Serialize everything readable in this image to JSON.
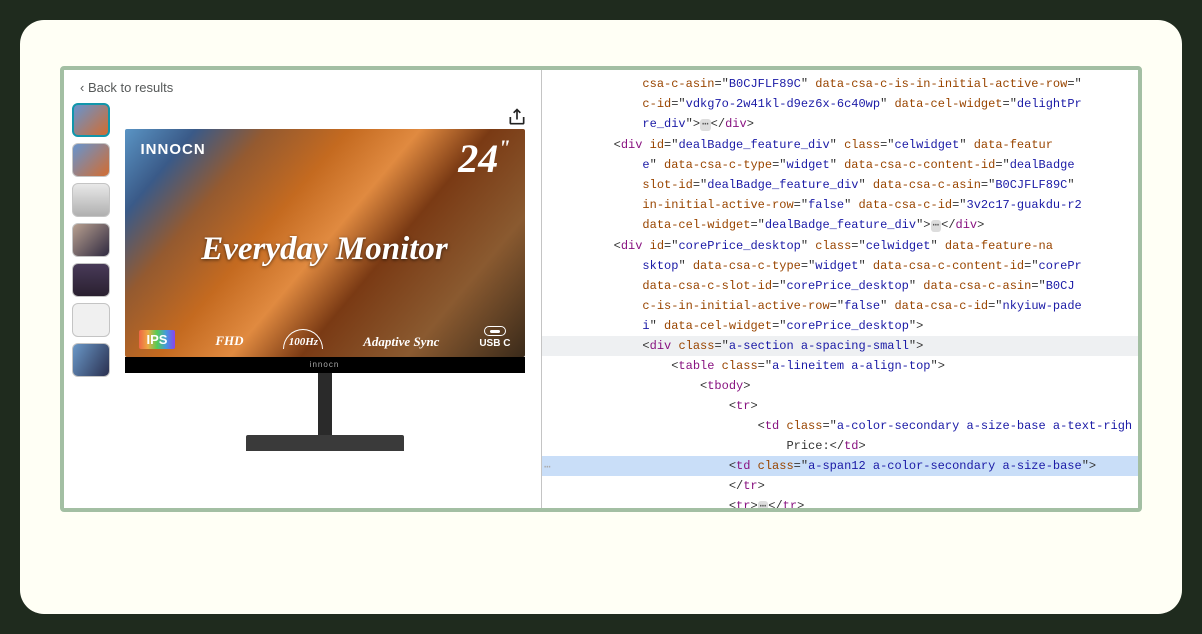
{
  "left": {
    "back_label": "Back to results",
    "thumbnails": [
      "t1",
      "t1",
      "t2",
      "t3",
      "t4",
      "t5",
      "t6"
    ],
    "product": {
      "brand": "INNOCN",
      "size_label": "24",
      "size_suffix": "\"",
      "hero": "Everyday Monitor",
      "ips": "IPS",
      "fhd": "FHD",
      "hz": "100Hz",
      "sync": "Adaptive Sync",
      "usbc": "USB C",
      "bezel_brand": "innocn"
    }
  },
  "code": {
    "lines": [
      {
        "indent": 6,
        "arrow": "",
        "tokens": [
          [
            "attr-name",
            "csa-c-asin"
          ],
          [
            "punct",
            "=\""
          ],
          [
            "attr-val",
            "B0CJFLF89C"
          ],
          [
            "punct",
            "\" "
          ],
          [
            "attr-name",
            "data-csa-c-is-in-initial-active-row"
          ],
          [
            "punct",
            "=\""
          ]
        ]
      },
      {
        "indent": 6,
        "arrow": "",
        "tokens": [
          [
            "attr-name",
            "c-id"
          ],
          [
            "punct",
            "=\""
          ],
          [
            "attr-val",
            "vdkg7o-2w41kl-d9ez6x-6c40wp"
          ],
          [
            "punct",
            "\" "
          ],
          [
            "attr-name",
            "data-cel-widget"
          ],
          [
            "punct",
            "=\""
          ],
          [
            "attr-val",
            "delightPr"
          ]
        ]
      },
      {
        "indent": 6,
        "arrow": "",
        "tokens": [
          [
            "attr-val",
            "re_div"
          ],
          [
            "punct",
            "\">"
          ],
          [
            "ell",
            "⋯"
          ],
          [
            "punct",
            "</"
          ],
          [
            "tag",
            "div"
          ],
          [
            "punct",
            ">"
          ]
        ]
      },
      {
        "indent": 4,
        "arrow": "▶",
        "tokens": [
          [
            "punct",
            "<"
          ],
          [
            "tag",
            "div"
          ],
          [
            "punct",
            " "
          ],
          [
            "attr-name",
            "id"
          ],
          [
            "punct",
            "=\""
          ],
          [
            "attr-val",
            "dealBadge_feature_div"
          ],
          [
            "punct",
            "\" "
          ],
          [
            "attr-name",
            "class"
          ],
          [
            "punct",
            "=\""
          ],
          [
            "attr-val",
            "celwidget"
          ],
          [
            "punct",
            "\" "
          ],
          [
            "attr-name",
            "data-featur"
          ]
        ]
      },
      {
        "indent": 6,
        "arrow": "",
        "tokens": [
          [
            "attr-val",
            "e"
          ],
          [
            "punct",
            "\" "
          ],
          [
            "attr-name",
            "data-csa-c-type"
          ],
          [
            "punct",
            "=\""
          ],
          [
            "attr-val",
            "widget"
          ],
          [
            "punct",
            "\" "
          ],
          [
            "attr-name",
            "data-csa-c-content-id"
          ],
          [
            "punct",
            "=\""
          ],
          [
            "attr-val",
            "dealBadge"
          ]
        ]
      },
      {
        "indent": 6,
        "arrow": "",
        "tokens": [
          [
            "attr-name",
            "slot-id"
          ],
          [
            "punct",
            "=\""
          ],
          [
            "attr-val",
            "dealBadge_feature_div"
          ],
          [
            "punct",
            "\" "
          ],
          [
            "attr-name",
            "data-csa-c-asin"
          ],
          [
            "punct",
            "=\""
          ],
          [
            "attr-val",
            "B0CJFLF89C"
          ],
          [
            "punct",
            "\""
          ]
        ]
      },
      {
        "indent": 6,
        "arrow": "",
        "tokens": [
          [
            "attr-name",
            "in-initial-active-row"
          ],
          [
            "punct",
            "=\""
          ],
          [
            "attr-val",
            "false"
          ],
          [
            "punct",
            "\" "
          ],
          [
            "attr-name",
            "data-csa-c-id"
          ],
          [
            "punct",
            "=\""
          ],
          [
            "attr-val",
            "3v2c17-guakdu-r2"
          ]
        ]
      },
      {
        "indent": 6,
        "arrow": "",
        "tokens": [
          [
            "attr-name",
            "data-cel-widget"
          ],
          [
            "punct",
            "=\""
          ],
          [
            "attr-val",
            "dealBadge_feature_div"
          ],
          [
            "punct",
            "\">"
          ],
          [
            "ell",
            "⋯"
          ],
          [
            "punct",
            "</"
          ],
          [
            "tag",
            "div"
          ],
          [
            "punct",
            ">"
          ]
        ]
      },
      {
        "indent": 4,
        "arrow": "▼",
        "tokens": [
          [
            "punct",
            "<"
          ],
          [
            "tag",
            "div"
          ],
          [
            "punct",
            " "
          ],
          [
            "attr-name",
            "id"
          ],
          [
            "punct",
            "=\""
          ],
          [
            "attr-val",
            "corePrice_desktop"
          ],
          [
            "punct",
            "\" "
          ],
          [
            "attr-name",
            "class"
          ],
          [
            "punct",
            "=\""
          ],
          [
            "attr-val",
            "celwidget"
          ],
          [
            "punct",
            "\" "
          ],
          [
            "attr-name",
            "data-feature-na"
          ]
        ]
      },
      {
        "indent": 6,
        "arrow": "",
        "tokens": [
          [
            "attr-val",
            "sktop"
          ],
          [
            "punct",
            "\" "
          ],
          [
            "attr-name",
            "data-csa-c-type"
          ],
          [
            "punct",
            "=\""
          ],
          [
            "attr-val",
            "widget"
          ],
          [
            "punct",
            "\" "
          ],
          [
            "attr-name",
            "data-csa-c-content-id"
          ],
          [
            "punct",
            "=\""
          ],
          [
            "attr-val",
            "corePr"
          ]
        ]
      },
      {
        "indent": 6,
        "arrow": "",
        "tokens": [
          [
            "attr-name",
            "data-csa-c-slot-id"
          ],
          [
            "punct",
            "=\""
          ],
          [
            "attr-val",
            "corePrice_desktop"
          ],
          [
            "punct",
            "\" "
          ],
          [
            "attr-name",
            "data-csa-c-asin"
          ],
          [
            "punct",
            "=\""
          ],
          [
            "attr-val",
            "B0CJ"
          ]
        ]
      },
      {
        "indent": 6,
        "arrow": "",
        "tokens": [
          [
            "attr-name",
            "c-is-in-initial-active-row"
          ],
          [
            "punct",
            "=\""
          ],
          [
            "attr-val",
            "false"
          ],
          [
            "punct",
            "\" "
          ],
          [
            "attr-name",
            "data-csa-c-id"
          ],
          [
            "punct",
            "=\""
          ],
          [
            "attr-val",
            "nkyiuw-pade"
          ]
        ]
      },
      {
        "indent": 6,
        "arrow": "",
        "tokens": [
          [
            "attr-val",
            "i"
          ],
          [
            "punct",
            "\" "
          ],
          [
            "attr-name",
            "data-cel-widget"
          ],
          [
            "punct",
            "=\""
          ],
          [
            "attr-val",
            "corePrice_desktop"
          ],
          [
            "punct",
            "\">"
          ]
        ]
      },
      {
        "indent": 6,
        "arrow": "▼",
        "highlight": true,
        "tokens": [
          [
            "punct",
            "<"
          ],
          [
            "tag",
            "div"
          ],
          [
            "punct",
            " "
          ],
          [
            "attr-name",
            "class"
          ],
          [
            "punct",
            "=\""
          ],
          [
            "attr-val",
            "a-section a-spacing-small"
          ],
          [
            "punct",
            "\">"
          ]
        ]
      },
      {
        "indent": 8,
        "arrow": "▼",
        "tokens": [
          [
            "punct",
            "<"
          ],
          [
            "tag",
            "table"
          ],
          [
            "punct",
            " "
          ],
          [
            "attr-name",
            "class"
          ],
          [
            "punct",
            "=\""
          ],
          [
            "attr-val",
            "a-lineitem a-align-top"
          ],
          [
            "punct",
            "\">"
          ]
        ]
      },
      {
        "indent": 10,
        "arrow": "▼",
        "tokens": [
          [
            "punct",
            "<"
          ],
          [
            "tag",
            "tbody"
          ],
          [
            "punct",
            ">"
          ]
        ]
      },
      {
        "indent": 12,
        "arrow": "▼",
        "tokens": [
          [
            "punct",
            "<"
          ],
          [
            "tag",
            "tr"
          ],
          [
            "punct",
            ">"
          ]
        ]
      },
      {
        "indent": 14,
        "arrow": "",
        "tokens": [
          [
            "punct",
            "<"
          ],
          [
            "tag",
            "td"
          ],
          [
            "punct",
            " "
          ],
          [
            "attr-name",
            "class"
          ],
          [
            "punct",
            "=\""
          ],
          [
            "attr-val",
            "a-color-secondary a-size-base a-text-righ"
          ]
        ]
      },
      {
        "indent": 16,
        "arrow": "",
        "tokens": [
          [
            "punct",
            "Price:</"
          ],
          [
            "tag",
            "td"
          ],
          [
            "punct",
            ">"
          ]
        ]
      },
      {
        "indent": 12,
        "arrow": "▶",
        "highlight2": true,
        "tokens": [
          [
            "punct",
            "<"
          ],
          [
            "tag",
            "td"
          ],
          [
            "punct",
            " "
          ],
          [
            "attr-name",
            "class"
          ],
          [
            "punct",
            "=\""
          ],
          [
            "attr-val",
            "a-span12 a-color-secondary a-size-base"
          ],
          [
            "punct",
            "\">"
          ]
        ]
      },
      {
        "indent": 12,
        "arrow": "",
        "tokens": [
          [
            "punct",
            "</"
          ],
          [
            "tag",
            "tr"
          ],
          [
            "punct",
            ">"
          ]
        ]
      },
      {
        "indent": 12,
        "arrow": "▶",
        "tokens": [
          [
            "punct",
            "<"
          ],
          [
            "tag",
            "tr"
          ],
          [
            "punct",
            ">"
          ],
          [
            "ell",
            "⋯"
          ],
          [
            "punct",
            "</"
          ],
          [
            "tag",
            "tr"
          ],
          [
            "punct",
            ">"
          ]
        ]
      }
    ]
  }
}
